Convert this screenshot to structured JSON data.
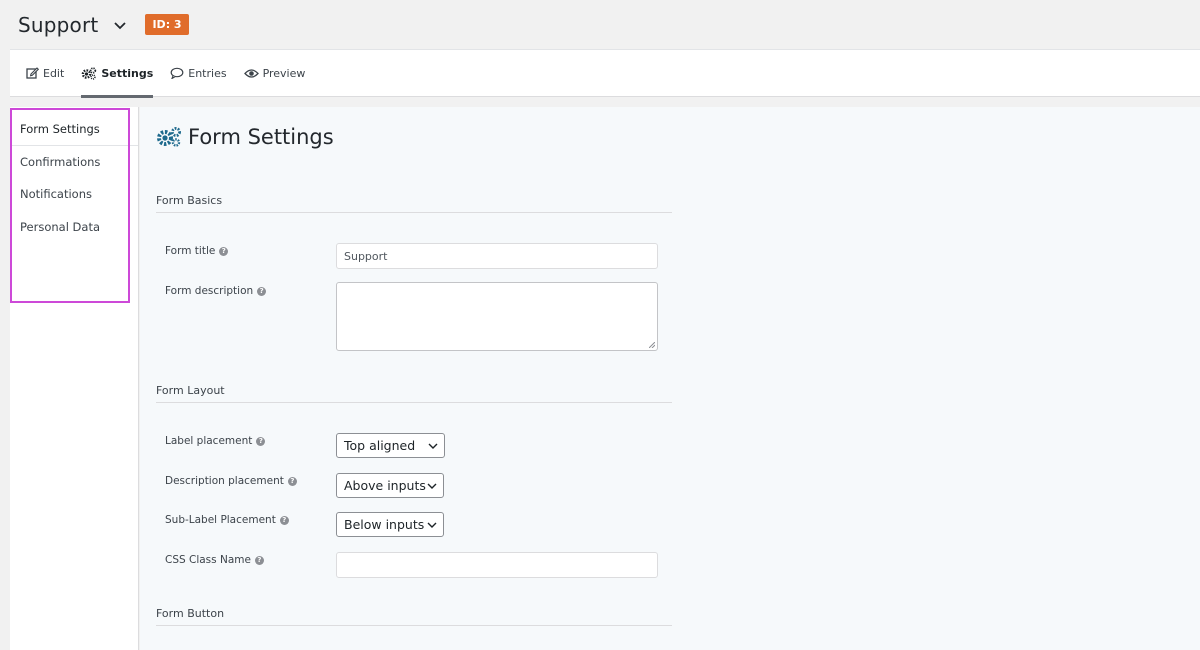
{
  "header": {
    "form_name": "Support",
    "id_badge": "ID: 3"
  },
  "toolbar": {
    "items": [
      {
        "label": "Edit",
        "icon": "edit-icon"
      },
      {
        "label": "Settings",
        "icon": "gears-icon",
        "active": true
      },
      {
        "label": "Entries",
        "icon": "comment-icon"
      },
      {
        "label": "Preview",
        "icon": "eye-icon"
      }
    ]
  },
  "sidebar": {
    "items": [
      {
        "label": "Form Settings",
        "active": true
      },
      {
        "label": "Confirmations"
      },
      {
        "label": "Notifications"
      },
      {
        "label": "Personal Data"
      }
    ]
  },
  "main": {
    "title": "Form Settings",
    "sections": {
      "basics": "Form Basics",
      "layout": "Form Layout",
      "button": "Form Button"
    },
    "fields": {
      "form_title_label": "Form title",
      "form_title_value": "Support",
      "form_description_label": "Form description",
      "label_placement_label": "Label placement",
      "label_placement_value": "Top aligned",
      "description_placement_label": "Description placement",
      "description_placement_value": "Above inputs",
      "sublabel_placement_label": "Sub-Label Placement",
      "sublabel_placement_value": "Below inputs",
      "css_class_label": "CSS Class Name"
    }
  },
  "colors": {
    "badge": "#e06c2b",
    "highlight": "#cd49d8",
    "gear_icon": "#1e6a8d"
  }
}
